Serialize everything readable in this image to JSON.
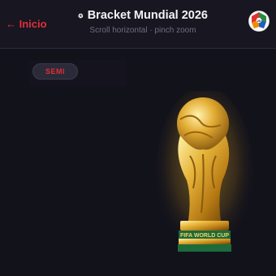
{
  "header": {
    "back_label": "← Inicio",
    "title": "Bracket Mundial 2026",
    "subtitle": "Scroll horizontal · pinch zoom",
    "title_icon": "soccer-ball-icon",
    "logo_icon": "tournament-logo-icon"
  },
  "bracket": {
    "round_label": "SEMI"
  },
  "trophy": {
    "base_text": "FIFA WORLD CUP",
    "name": "world-cup-trophy"
  },
  "colors": {
    "accent": "#e0303a",
    "background": "#12121b",
    "header": "#171621",
    "gold": "#d9a22a"
  }
}
